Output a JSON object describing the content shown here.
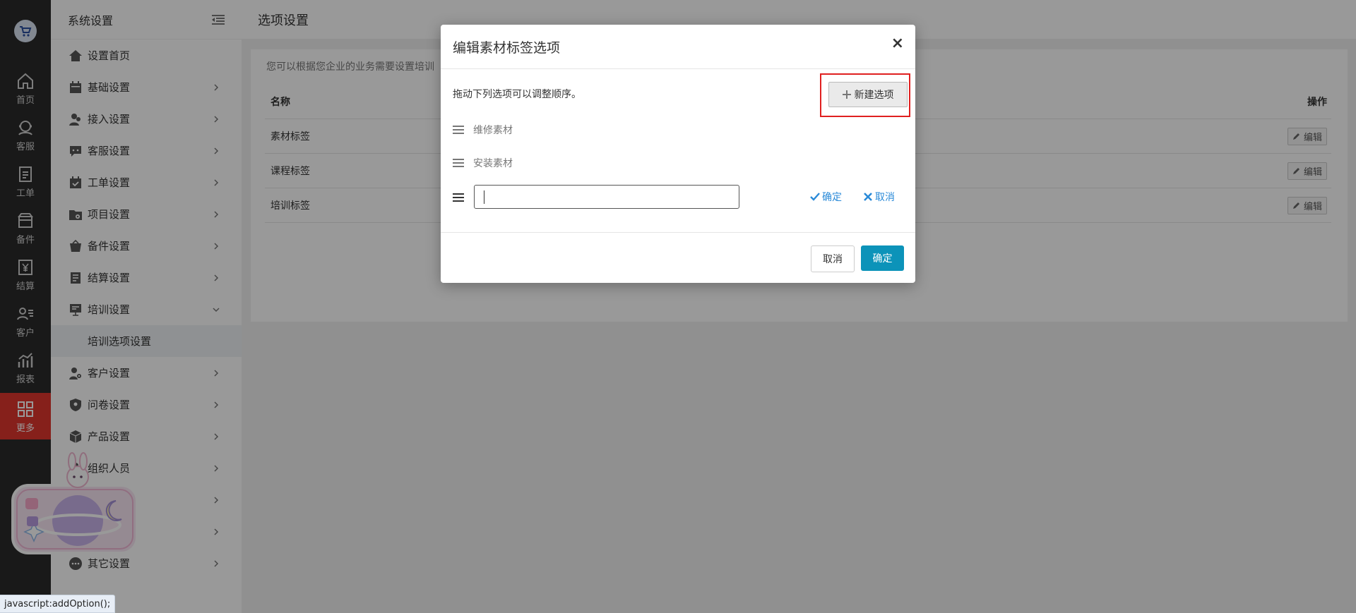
{
  "rail": {
    "items": [
      {
        "label": "首页",
        "icon": "home-icon"
      },
      {
        "label": "客服",
        "icon": "headset-icon"
      },
      {
        "label": "工单",
        "icon": "clipboard-icon"
      },
      {
        "label": "备件",
        "icon": "box-icon"
      },
      {
        "label": "结算",
        "icon": "yen-icon"
      },
      {
        "label": "客户",
        "icon": "user-list-icon"
      },
      {
        "label": "报表",
        "icon": "chart-icon"
      },
      {
        "label": "更多",
        "icon": "grid-icon"
      }
    ]
  },
  "sidebar": {
    "title": "系统设置",
    "items": [
      {
        "label": "设置首页"
      },
      {
        "label": "基础设置"
      },
      {
        "label": "接入设置"
      },
      {
        "label": "客服设置"
      },
      {
        "label": "工单设置"
      },
      {
        "label": "项目设置"
      },
      {
        "label": "备件设置"
      },
      {
        "label": "结算设置"
      },
      {
        "label": "培训设置"
      },
      {
        "label": "培训选项设置"
      },
      {
        "label": "客户设置"
      },
      {
        "label": "问卷设置"
      },
      {
        "label": "产品设置"
      },
      {
        "label": "组织人员"
      },
      {
        "label": "其它设置"
      }
    ]
  },
  "main": {
    "title": "选项设置",
    "hint": "您可以根据您企业的业务需要设置培训",
    "table": {
      "headers": [
        "名称",
        "操作"
      ],
      "rows": [
        "素材标签",
        "课程标签",
        "培训标签"
      ],
      "edit_label": "编辑"
    }
  },
  "modal": {
    "title": "编辑素材标签选项",
    "close": "×",
    "desc": "拖动下列选项可以调整顺序。",
    "new_option": "新建选项",
    "options": [
      "维修素材",
      "安装素材"
    ],
    "input_value": "",
    "confirm_link": "确定",
    "cancel_link": "取消",
    "cancel_button": "取消",
    "ok_button": "确定"
  },
  "statusbar": "javascript:addOption();",
  "colors": {
    "accent": "#0c93b9",
    "active_rail": "#e0362d",
    "highlight": "#e02020",
    "link": "#2a8ad8"
  }
}
